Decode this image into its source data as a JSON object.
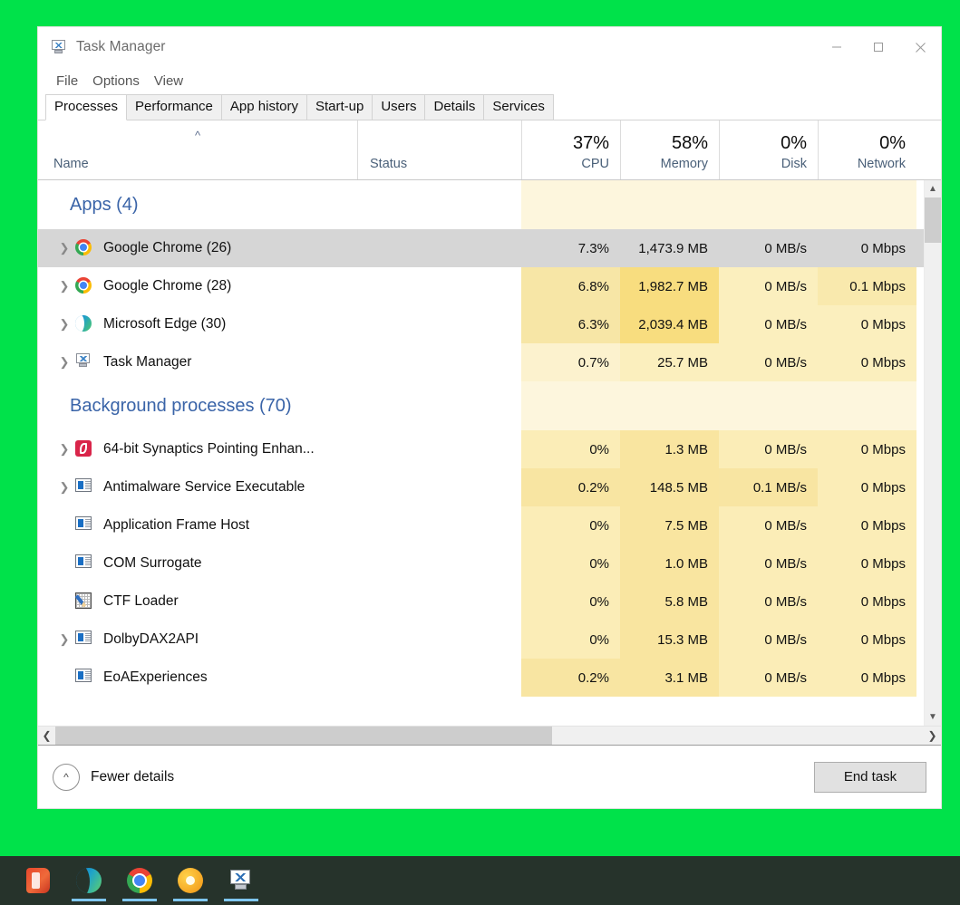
{
  "window": {
    "title": "Task Manager",
    "icon": "task-manager-icon",
    "controls": {
      "minimize": "minimize-icon",
      "maximize": "maximize-icon",
      "close": "close-icon"
    }
  },
  "menu": {
    "items": [
      "File",
      "Options",
      "View"
    ]
  },
  "tabs": [
    {
      "label": "Processes",
      "active": true
    },
    {
      "label": "Performance",
      "active": false
    },
    {
      "label": "App history",
      "active": false
    },
    {
      "label": "Start-up",
      "active": false
    },
    {
      "label": "Users",
      "active": false
    },
    {
      "label": "Details",
      "active": false
    },
    {
      "label": "Services",
      "active": false
    }
  ],
  "columns": {
    "name": {
      "label": "Name",
      "sort": "ascending",
      "sort_icon": "chevron-up-icon"
    },
    "status": {
      "label": "Status"
    },
    "cpu": {
      "label": "CPU",
      "percent": "37%"
    },
    "memory": {
      "label": "Memory",
      "percent": "58%"
    },
    "disk": {
      "label": "Disk",
      "percent": "0%"
    },
    "network": {
      "label": "Network",
      "percent": "0%"
    }
  },
  "groups": [
    {
      "title": "Apps (4)",
      "bg": {
        "cpu": "#fdf6dd",
        "memory": "#fdf6dd",
        "disk": "#fdf6dd",
        "network": "#fdf6dd"
      }
    },
    {
      "title": "Background processes (70)",
      "bg": {
        "cpu": "#fdf6dd",
        "memory": "#fdf6dd",
        "disk": "#fdf6dd",
        "network": "#fdf6dd"
      }
    }
  ],
  "rows": [
    {
      "group": 0,
      "name": "Google Chrome (26)",
      "icon": "chrome-icon",
      "expandable": true,
      "selected": true,
      "cpu": "7.3%",
      "memory": "1,473.9 MB",
      "disk": "0 MB/s",
      "network": "0 Mbps",
      "bg": {
        "cpu": "#d6d6d6",
        "memory": "#d6d6d6",
        "disk": "#d6d6d6",
        "network": "#d6d6d6"
      }
    },
    {
      "group": 0,
      "name": "Google Chrome (28)",
      "icon": "chrome-icon",
      "expandable": true,
      "selected": false,
      "cpu": "6.8%",
      "memory": "1,982.7 MB",
      "disk": "0 MB/s",
      "network": "0.1 Mbps",
      "bg": {
        "cpu": "#f7e6a6",
        "memory": "#f8dd7f",
        "disk": "#fbefbe",
        "network": "#f9e9ad"
      }
    },
    {
      "group": 0,
      "name": "Microsoft Edge (30)",
      "icon": "edge-icon",
      "expandable": true,
      "selected": false,
      "cpu": "6.3%",
      "memory": "2,039.4 MB",
      "disk": "0 MB/s",
      "network": "0 Mbps",
      "bg": {
        "cpu": "#f7e6a6",
        "memory": "#f8dd7f",
        "disk": "#fbefbe",
        "network": "#fbefbe"
      }
    },
    {
      "group": 0,
      "name": "Task Manager",
      "icon": "task-manager-icon",
      "expandable": true,
      "selected": false,
      "cpu": "0.7%",
      "memory": "25.7 MB",
      "disk": "0 MB/s",
      "network": "0 Mbps",
      "bg": {
        "cpu": "#fcf2ce",
        "memory": "#fbefbe",
        "disk": "#fbefbe",
        "network": "#fbefbe"
      }
    },
    {
      "group": 1,
      "name": "64-bit Synaptics Pointing Enhan...",
      "icon": "synaptics-icon",
      "expandable": true,
      "selected": false,
      "cpu": "0%",
      "memory": "1.3 MB",
      "disk": "0 MB/s",
      "network": "0 Mbps",
      "bg": {
        "cpu": "#fbedb7",
        "memory": "#f9e5a0",
        "disk": "#fbedb7",
        "network": "#fbedb7"
      }
    },
    {
      "group": 1,
      "name": "Antimalware Service Executable",
      "icon": "window-icon",
      "expandable": true,
      "selected": false,
      "cpu": "0.2%",
      "memory": "148.5 MB",
      "disk": "0.1 MB/s",
      "network": "0 Mbps",
      "bg": {
        "cpu": "#f8e5a2",
        "memory": "#f9e5a0",
        "disk": "#f8e5a2",
        "network": "#fbedb7"
      }
    },
    {
      "group": 1,
      "name": "Application Frame Host",
      "icon": "window-icon",
      "expandable": false,
      "selected": false,
      "cpu": "0%",
      "memory": "7.5 MB",
      "disk": "0 MB/s",
      "network": "0 Mbps",
      "bg": {
        "cpu": "#fbedb7",
        "memory": "#f9e5a0",
        "disk": "#fbedb7",
        "network": "#fbedb7"
      }
    },
    {
      "group": 1,
      "name": "COM Surrogate",
      "icon": "window-icon",
      "expandable": false,
      "selected": false,
      "cpu": "0%",
      "memory": "1.0 MB",
      "disk": "0 MB/s",
      "network": "0 Mbps",
      "bg": {
        "cpu": "#fbedb7",
        "memory": "#f9e5a0",
        "disk": "#fbedb7",
        "network": "#fbedb7"
      }
    },
    {
      "group": 1,
      "name": "CTF Loader",
      "icon": "ctf-loader-icon",
      "expandable": false,
      "selected": false,
      "cpu": "0%",
      "memory": "5.8 MB",
      "disk": "0 MB/s",
      "network": "0 Mbps",
      "bg": {
        "cpu": "#fbedb7",
        "memory": "#f9e5a0",
        "disk": "#fbedb7",
        "network": "#fbedb7"
      }
    },
    {
      "group": 1,
      "name": "DolbyDAX2API",
      "icon": "window-icon",
      "expandable": true,
      "selected": false,
      "cpu": "0%",
      "memory": "15.3 MB",
      "disk": "0 MB/s",
      "network": "0 Mbps",
      "bg": {
        "cpu": "#fbedb7",
        "memory": "#f9e5a0",
        "disk": "#fbedb7",
        "network": "#fbedb7"
      }
    },
    {
      "group": 1,
      "name": "EoAExperiences",
      "icon": "window-icon",
      "expandable": false,
      "selected": false,
      "cpu": "0.2%",
      "memory": "3.1 MB",
      "disk": "0 MB/s",
      "network": "0 Mbps",
      "bg": {
        "cpu": "#f8e5a2",
        "memory": "#f9e5a0",
        "disk": "#fbedb7",
        "network": "#fbedb7"
      }
    }
  ],
  "footer": {
    "fewer_details": "Fewer details",
    "fewer_details_icon": "chevron-up-circle-icon",
    "end_task": "End task"
  },
  "scrollbars": {
    "vertical": {
      "up_icon": "chevron-up-icon",
      "down_icon": "chevron-down-icon"
    },
    "horizontal": {
      "left_icon": "chevron-left-icon",
      "right_icon": "chevron-right-icon"
    }
  },
  "taskbar": {
    "items": [
      {
        "name": "office-icon",
        "cls": "tb-office",
        "running": false
      },
      {
        "name": "edge-icon",
        "cls": "tb-edge",
        "running": true
      },
      {
        "name": "chrome-icon",
        "cls": "tb-chrome",
        "running": true
      },
      {
        "name": "chrome-canary-icon",
        "cls": "tb-canary",
        "running": true
      },
      {
        "name": "task-manager-icon",
        "cls": "tb-tm",
        "running": true
      }
    ]
  },
  "colors": {
    "desktop": "#00e24a",
    "taskbar": "#26332b",
    "group_title": "#3a64a8",
    "selection": "#d6d6d6"
  }
}
